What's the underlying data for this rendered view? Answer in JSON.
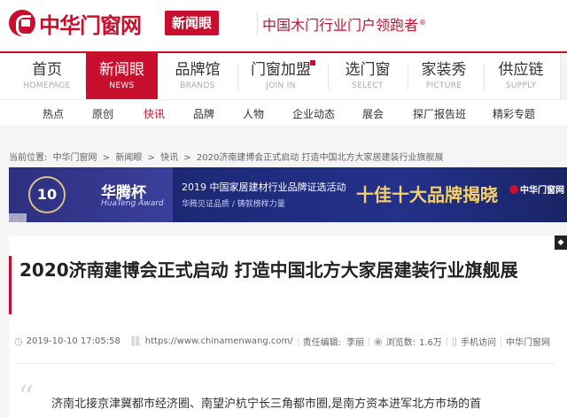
{
  "header": {
    "logo_text": "中华门窗网",
    "section_tag": "新闻眼",
    "slogan": "中国木门行业门户领跑者",
    "slogan_mark": "®"
  },
  "main_nav": [
    {
      "cn": "首页",
      "en": "HOMEPAGE"
    },
    {
      "cn": "新闻眼",
      "en": "NEWS",
      "active": true
    },
    {
      "cn": "品牌馆",
      "en": "BRANDS"
    },
    {
      "cn": "门窗加盟",
      "en": "JOIN IN"
    },
    {
      "cn": "选门窗",
      "en": "SELECT"
    },
    {
      "cn": "家装秀",
      "en": "PICTURE"
    },
    {
      "cn": "供应链",
      "en": "SUPPLY"
    }
  ],
  "sub_nav": [
    "热点",
    "原创",
    "快讯",
    "品牌",
    "人物",
    "企业动态",
    "展会",
    "探厂报告班",
    "精彩专题"
  ],
  "sub_nav_active": "快讯",
  "breadcrumb": {
    "prefix": "当前位置:",
    "items": [
      "中华门窗网",
      ">",
      "新闻眼",
      ">",
      "快讯",
      ">",
      "2020济南建博会正式启动 打造中国北方大家居建装行业旗舰展"
    ]
  },
  "banner": {
    "ten": "10",
    "award_title": "华腾杯",
    "award_en": "HuaTeng Award",
    "activity": "2019 中国家居建材行业品牌证选活动",
    "sub": "华腾见证品质 / 铸就榜样力量",
    "big": "十佳十大品牌揭晓",
    "logo": "中华门窗网",
    "ad_label": "广告"
  },
  "article": {
    "title": "2020济南建博会正式启动 打造中国北方大家居建装行业旗舰展",
    "date": "2019-10-10 17:05:58",
    "url": "https://www.chinamenwang.com/",
    "editor_label": "责任编辑:",
    "editor": "李丽",
    "views_label": "浏览数:",
    "views": "1.6万",
    "mobile": "手机访问",
    "source": "中华门窗网",
    "lead": "济南北接京津冀都市经济圈、南望沪杭宁长三角都市圈,是南方资本进军北方市场的首"
  },
  "colors": {
    "brand_red": "#c8102e",
    "banner_navy": "#1d2a78",
    "banner_gold": "#f5d06b"
  }
}
